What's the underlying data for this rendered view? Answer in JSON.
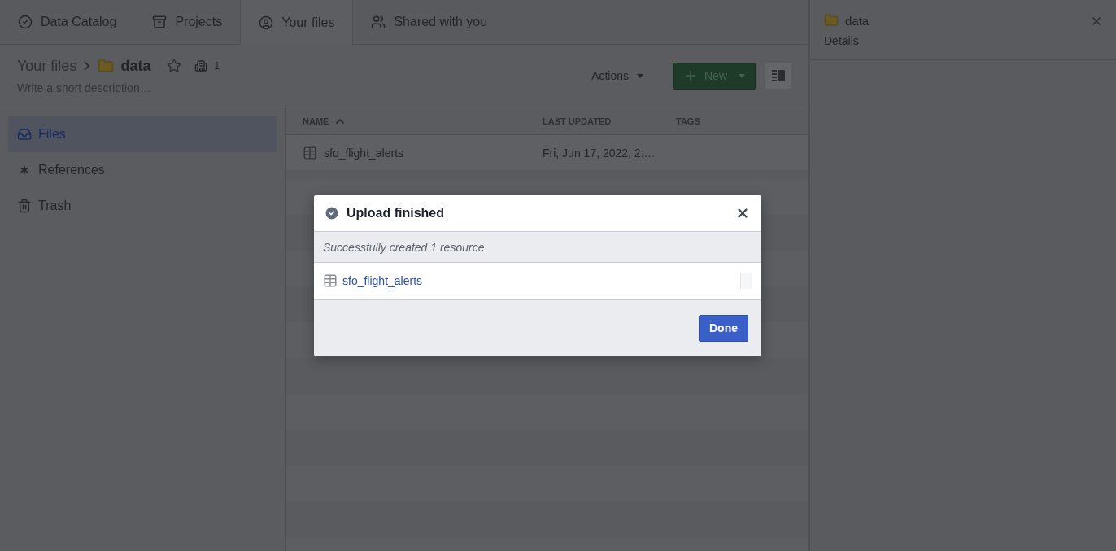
{
  "tabs": [
    {
      "label": "Data Catalog",
      "selected": false
    },
    {
      "label": "Projects",
      "selected": false
    },
    {
      "label": "Your files",
      "selected": true
    },
    {
      "label": "Shared with you",
      "selected": false
    }
  ],
  "header": {
    "breadcrumb_root": "Your files",
    "folder": "data",
    "starred": false,
    "member_count": "1",
    "description_placeholder": "Write a short description…",
    "actions": "Actions",
    "new_button": "New"
  },
  "sidebar": {
    "items": [
      {
        "label": "Files",
        "selected": true
      },
      {
        "label": "References",
        "selected": false
      },
      {
        "label": "Trash",
        "selected": false
      }
    ]
  },
  "table": {
    "columns": [
      {
        "label": "NAME",
        "sorted": true
      },
      {
        "label": "LAST UPDATED",
        "sorted": false
      },
      {
        "label": "TAGS",
        "sorted": false
      }
    ],
    "rows": [
      {
        "name": "sfo_flight_alerts",
        "last_updated": "Fri, Jun 17, 2022, 2:…"
      }
    ]
  },
  "details_panel": {
    "title": "data",
    "subtitle": "Details"
  },
  "dialog": {
    "title": "Upload finished",
    "message": "Successfully created 1 resource",
    "resources": [
      "sfo_flight_alerts"
    ],
    "done_button": "Done"
  }
}
